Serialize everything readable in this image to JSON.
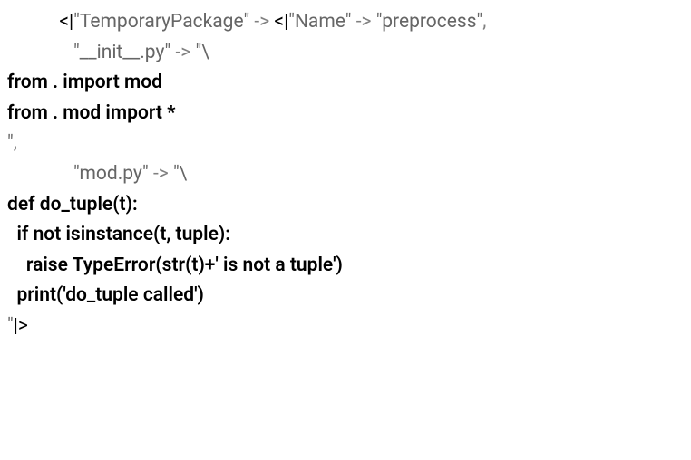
{
  "line1": {
    "prefix": "           ",
    "open": "<|",
    "key1": "\"TemporaryPackage\"",
    "arrow1": " -> ",
    "open2": "<|",
    "key2": "\"Name\"",
    "arrow2": " -> ",
    "val2": "\"preprocess\"",
    "close": ","
  },
  "line2": {
    "prefix": "              ",
    "key": "\"__init__.py\"",
    "arrow": " -> ",
    "open": "\"\\"
  },
  "line3": "from . import mod",
  "line4": "from . mod import *",
  "line5": {
    "prefix": "",
    "close": "\"",
    "comma": ","
  },
  "line6": {
    "prefix": "              ",
    "key": "\"mod.py\"",
    "arrow": " -> ",
    "open": "\"\\"
  },
  "line7": "def do_tuple(t):",
  "line8": "  if not isinstance(t, tuple):",
  "line9": "    raise TypeError(str(t)+' is not a tuple')",
  "line10": "  print('do_tuple called')",
  "line11": {
    "prefix": "",
    "close": "\"",
    "brackets": "|>"
  }
}
